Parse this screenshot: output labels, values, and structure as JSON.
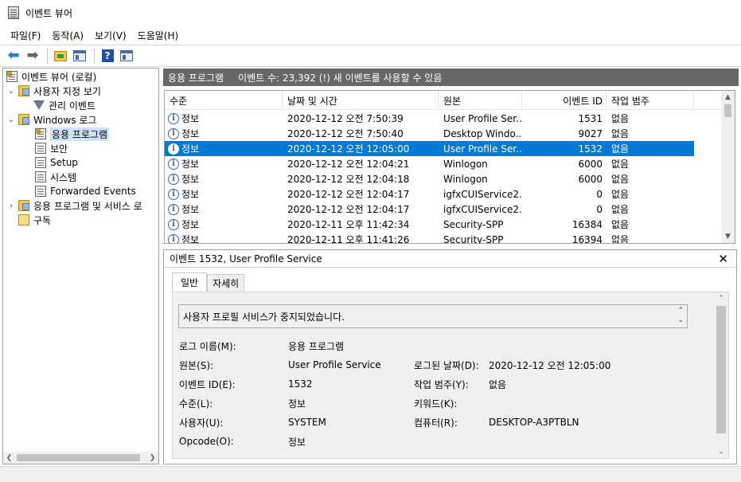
{
  "window": {
    "title": "이벤트 뷰어"
  },
  "menu": [
    "파일(F)",
    "동작(A)",
    "보기(V)",
    "도움말(H)"
  ],
  "toolbar": {
    "back_icon": "back-arrow-icon",
    "forward_icon": "forward-arrow-icon",
    "folder_icon": "open-folder-icon",
    "panel_icon": "show-hide-panel-icon",
    "help_icon": "help-icon",
    "help_glyph": "?",
    "panel2_icon": "action-pane-icon"
  },
  "tree": {
    "items": [
      {
        "label": "이벤트 뷰어 (로컬)",
        "icon": "event-viewer-icon",
        "twisty": ""
      },
      {
        "label": "사용자 지정 보기",
        "icon": "folder-icon",
        "twisty": "⌄"
      },
      {
        "label": "관리 이벤트",
        "icon": "filter-icon",
        "twisty": ""
      },
      {
        "label": "Windows 로그",
        "icon": "folder-icon",
        "twisty": "⌄"
      },
      {
        "label": "응용 프로그램",
        "icon": "log-icon",
        "twisty": ""
      },
      {
        "label": "보안",
        "icon": "log-icon",
        "twisty": ""
      },
      {
        "label": "Setup",
        "icon": "log-icon",
        "twisty": ""
      },
      {
        "label": "시스템",
        "icon": "log-icon",
        "twisty": ""
      },
      {
        "label": "Forwarded Events",
        "icon": "log-icon",
        "twisty": ""
      },
      {
        "label": "응용 프로그램 및 서비스 로",
        "icon": "folder-icon",
        "twisty": "›"
      },
      {
        "label": "구독",
        "icon": "subscription-icon",
        "twisty": ""
      }
    ],
    "selected": "응용 프로그램"
  },
  "log_header": {
    "name": "응용 프로그램",
    "count_text": "이벤트 수: 23,392 (!) 새 이벤트를 사용할 수 있음"
  },
  "events": {
    "columns": [
      "수준",
      "날짜 및 시간",
      "원본",
      "이벤트 ID",
      "작업 범주"
    ],
    "rows": [
      {
        "level": "정보",
        "datetime": "2020-12-12 오전 7:50:39",
        "source": "User Profile Ser...",
        "event_id": "1531",
        "category": "없음"
      },
      {
        "level": "정보",
        "datetime": "2020-12-12 오전 7:50:40",
        "source": "Desktop Windo...",
        "event_id": "9027",
        "category": "없음"
      },
      {
        "level": "정보",
        "datetime": "2020-12-12 오전 12:05:00",
        "source": "User Profile Ser...",
        "event_id": "1532",
        "category": "없음"
      },
      {
        "level": "정보",
        "datetime": "2020-12-12 오전 12:04:21",
        "source": "Winlogon",
        "event_id": "6000",
        "category": "없음"
      },
      {
        "level": "정보",
        "datetime": "2020-12-12 오전 12:04:18",
        "source": "Winlogon",
        "event_id": "6000",
        "category": "없음"
      },
      {
        "level": "정보",
        "datetime": "2020-12-12 오전 12:04:17",
        "source": "igfxCUIService2...",
        "event_id": "0",
        "category": "없음"
      },
      {
        "level": "정보",
        "datetime": "2020-12-12 오전 12:04:17",
        "source": "igfxCUIService2...",
        "event_id": "0",
        "category": "없음"
      },
      {
        "level": "정보",
        "datetime": "2020-12-11 오후 11:42:34",
        "source": "Security-SPP",
        "event_id": "16384",
        "category": "없음"
      },
      {
        "level": "정보",
        "datetime": "2020-12-11 오후 11:41:26",
        "source": "Security-SPP",
        "event_id": "16394",
        "category": "없음"
      }
    ],
    "selected_index": 2,
    "level_icon": "info-icon",
    "level_glyph": "i"
  },
  "detail": {
    "title": "이벤트 1532, User Profile Service",
    "close_glyph": "✕",
    "tabs": [
      "일반",
      "자세히"
    ],
    "active_tab": "일반",
    "message": "사용자 프로필 서비스가 중지되었습니다.",
    "fields": {
      "log_name_label": "로그 이름(M):",
      "log_name": "응용 프로그램",
      "source_label": "원본(S):",
      "source": "User Profile Service",
      "logged_label": "로그된 날짜(D):",
      "logged": "2020-12-12 오전 12:05:00",
      "event_id_label": "이벤트 ID(E):",
      "event_id": "1532",
      "category_label": "작업 범주(Y):",
      "category": "없음",
      "level_label": "수준(L):",
      "level": "정보",
      "keywords_label": "키워드(K):",
      "keywords": "",
      "user_label": "사용자(U):",
      "user": "SYSTEM",
      "computer_label": "컴퓨터(R):",
      "computer": "DESKTOP-A3PTBLN",
      "opcode_label": "Opcode(O):",
      "opcode": "정보"
    }
  }
}
